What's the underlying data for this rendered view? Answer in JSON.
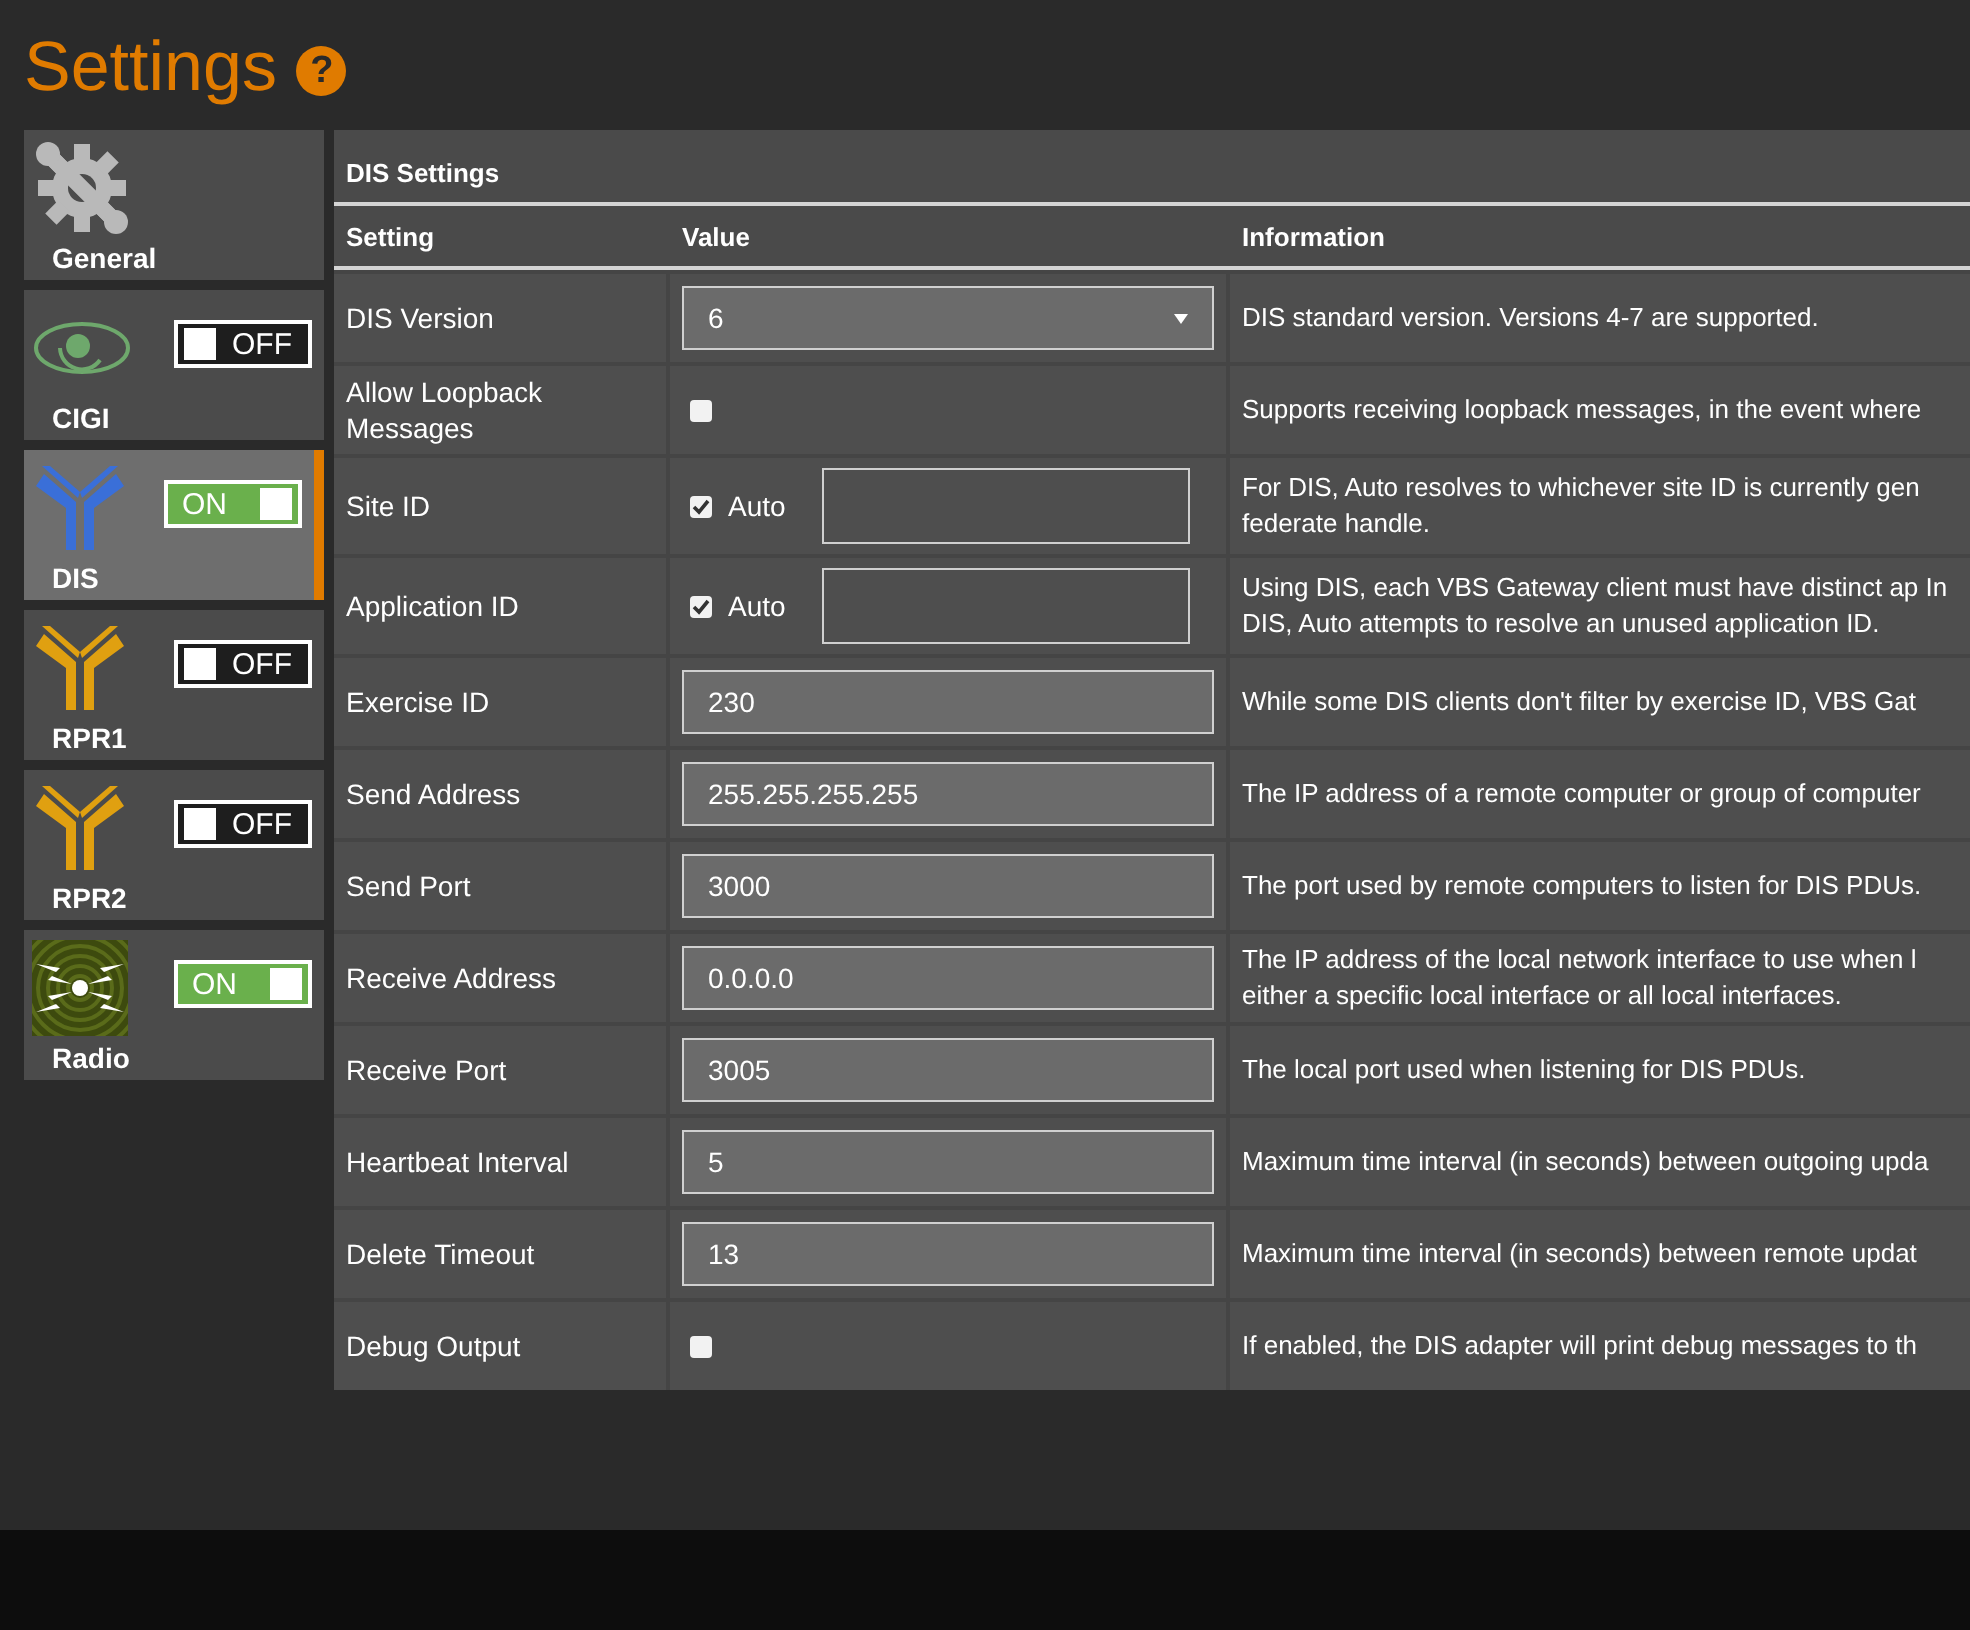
{
  "page": {
    "title": "Settings",
    "help_icon": "?"
  },
  "sidebar": {
    "items": [
      {
        "label": "General",
        "kind": "gear",
        "selected": false
      },
      {
        "label": "CIGI",
        "kind": "eye",
        "selected": false,
        "toggle": {
          "on": false,
          "label": "OFF"
        }
      },
      {
        "label": "DIS",
        "kind": "dis",
        "selected": true,
        "toggle": {
          "on": true,
          "label": "ON"
        }
      },
      {
        "label": "RPR1",
        "kind": "rpr",
        "selected": false,
        "toggle": {
          "on": false,
          "label": "OFF"
        }
      },
      {
        "label": "RPR2",
        "kind": "rpr",
        "selected": false,
        "toggle": {
          "on": false,
          "label": "OFF"
        }
      },
      {
        "label": "Radio",
        "kind": "radio",
        "selected": false,
        "toggle": {
          "on": true,
          "label": "ON"
        }
      }
    ]
  },
  "panel": {
    "title": "DIS Settings",
    "columns": [
      "Setting",
      "Value",
      "Information"
    ],
    "rows": [
      {
        "kind": "select",
        "setting": "DIS Version",
        "value": "6",
        "information": "DIS standard version. Versions 4-7 are supported."
      },
      {
        "kind": "checkbox",
        "setting": "Allow Loopback Messages",
        "checked": false,
        "information": "Supports receiving loopback messages, in the event where"
      },
      {
        "kind": "auto",
        "setting": "Site ID",
        "checked": true,
        "auto_label": "Auto",
        "information": "For DIS, Auto resolves to whichever site ID is currently gen federate handle."
      },
      {
        "kind": "auto",
        "setting": "Application ID",
        "checked": true,
        "auto_label": "Auto",
        "information": "Using DIS, each VBS Gateway client must have distinct ap In DIS, Auto attempts to resolve an unused application ID."
      },
      {
        "kind": "text",
        "setting": "Exercise ID",
        "value": "230",
        "information": "While some DIS clients don't filter by exercise ID, VBS Gat"
      },
      {
        "kind": "text",
        "setting": "Send Address",
        "value": "255.255.255.255",
        "information": "The IP address of a remote computer or group of computer"
      },
      {
        "kind": "text",
        "setting": "Send Port",
        "value": "3000",
        "information": "The port used by remote computers to listen for DIS PDUs."
      },
      {
        "kind": "text",
        "setting": "Receive Address",
        "value": "0.0.0.0",
        "information": "The IP address of the local network interface to use when l either a specific local interface or all local interfaces."
      },
      {
        "kind": "text",
        "setting": "Receive Port",
        "value": "3005",
        "information": "The local port used when listening for DIS PDUs."
      },
      {
        "kind": "text",
        "setting": "Heartbeat Interval",
        "value": "5",
        "information": "Maximum time interval (in seconds) between outgoing upda"
      },
      {
        "kind": "text",
        "setting": "Delete Timeout",
        "value": "13",
        "information": "Maximum time interval (in seconds) between remote updat"
      },
      {
        "kind": "checkbox",
        "setting": "Debug Output",
        "checked": false,
        "information": "If enabled, the DIS adapter will print debug messages to th"
      }
    ]
  }
}
